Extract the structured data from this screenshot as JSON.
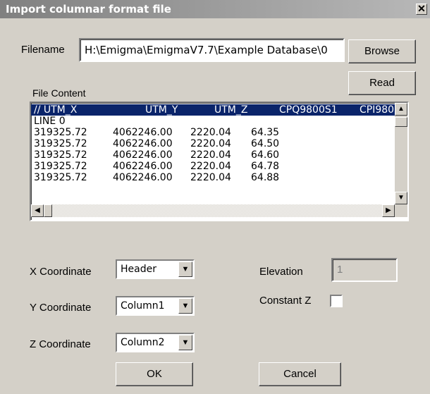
{
  "window": {
    "title": "Import columnar format file",
    "close_glyph": "✕"
  },
  "filename": {
    "label": "Filename",
    "value": "H:\\Emigma\\EmigmaV7.7\\Example Database\\0",
    "browse_label": "Browse",
    "read_label": "Read"
  },
  "file_content": {
    "label": "File Content",
    "header": [
      "// UTM_X",
      "UTM_Y",
      "UTM_Z",
      "CPQ9800S1",
      "CPI980"
    ],
    "rows": [
      [
        "LINE 0",
        "",
        "",
        ""
      ],
      [
        "319325.72",
        "4062246.00",
        "2220.04",
        "64.35"
      ],
      [
        "319325.72",
        "4062246.00",
        "2220.04",
        "64.50"
      ],
      [
        "319325.72",
        "4062246.00",
        "2220.04",
        "64.60"
      ],
      [
        "319325.72",
        "4062246.00",
        "2220.04",
        "64.78"
      ],
      [
        "319325.72",
        "4062246.00",
        "2220.04",
        "64.88"
      ]
    ]
  },
  "coords": {
    "x_label": "X Coordinate",
    "x_value": "Header",
    "y_label": "Y Coordinate",
    "y_value": "Column1",
    "z_label": "Z Coordinate",
    "z_value": "Column2"
  },
  "elevation": {
    "label": "Elevation",
    "value": "1"
  },
  "constant_z": {
    "label": "Constant Z",
    "checked": false
  },
  "buttons": {
    "ok_label": "OK",
    "cancel_label": "Cancel"
  },
  "icons": {
    "up": "▲",
    "down": "▼",
    "left": "◀",
    "right": "▶",
    "dropdown": "▼"
  },
  "colors": {
    "selection": "#0a246a",
    "face": "#d4d0c8"
  }
}
